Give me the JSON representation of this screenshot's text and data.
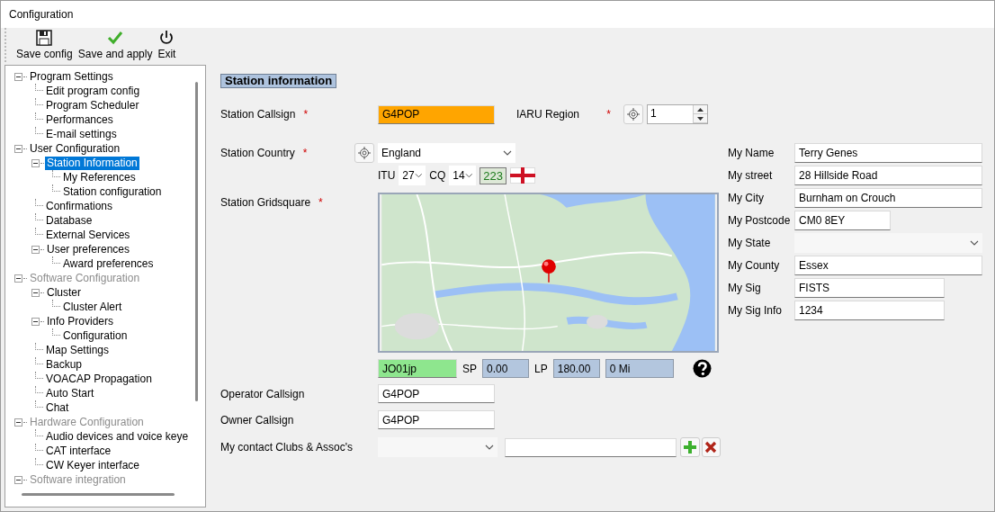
{
  "window": {
    "title": "Configuration"
  },
  "toolbar": [
    {
      "label": "Save config",
      "kind": "save"
    },
    {
      "label": "Save and apply",
      "kind": "apply"
    },
    {
      "label": "Exit",
      "kind": "exit"
    }
  ],
  "tree": [
    {
      "label": "Program Settings",
      "expanded": true,
      "disabled": false,
      "selected": false,
      "children": [
        {
          "label": "Edit program config",
          "disabled": false,
          "selected": false
        },
        {
          "label": "Program Scheduler",
          "disabled": false,
          "selected": false
        },
        {
          "label": "Performances",
          "disabled": false,
          "selected": false
        },
        {
          "label": "E-mail settings",
          "disabled": false,
          "selected": false
        }
      ]
    },
    {
      "label": "User Configuration",
      "expanded": true,
      "disabled": false,
      "selected": false,
      "children": [
        {
          "label": "Station Information",
          "expanded": true,
          "disabled": false,
          "selected": true,
          "children": [
            {
              "label": "My References",
              "disabled": false,
              "selected": false
            },
            {
              "label": "Station configuration",
              "disabled": false,
              "selected": false
            }
          ]
        },
        {
          "label": "Confirmations",
          "disabled": false,
          "selected": false
        },
        {
          "label": "Database",
          "disabled": false,
          "selected": false
        },
        {
          "label": "External Services",
          "disabled": false,
          "selected": false
        },
        {
          "label": "User preferences",
          "expanded": true,
          "disabled": false,
          "selected": false,
          "children": [
            {
              "label": "Award preferences",
              "disabled": false,
              "selected": false
            }
          ]
        }
      ]
    },
    {
      "label": "Software Configuration",
      "expanded": true,
      "disabled": true,
      "selected": false,
      "children": [
        {
          "label": "Cluster",
          "expanded": true,
          "disabled": false,
          "selected": false,
          "children": [
            {
              "label": "Cluster Alert",
              "disabled": false,
              "selected": false
            }
          ]
        },
        {
          "label": "Info Providers",
          "expanded": true,
          "disabled": false,
          "selected": false,
          "children": [
            {
              "label": "Configuration",
              "disabled": false,
              "selected": false
            }
          ]
        },
        {
          "label": "Map Settings",
          "disabled": false,
          "selected": false
        },
        {
          "label": "Backup",
          "disabled": false,
          "selected": false
        },
        {
          "label": "VOACAP Propagation",
          "disabled": false,
          "selected": false
        },
        {
          "label": "Auto Start",
          "disabled": false,
          "selected": false
        },
        {
          "label": "Chat",
          "disabled": false,
          "selected": false
        }
      ]
    },
    {
      "label": "Hardware Configuration",
      "expanded": true,
      "disabled": true,
      "selected": false,
      "children": [
        {
          "label": "Audio devices and voice keye",
          "disabled": false,
          "selected": false
        },
        {
          "label": "CAT interface",
          "disabled": false,
          "selected": false
        },
        {
          "label": "CW Keyer interface",
          "disabled": false,
          "selected": false
        }
      ]
    },
    {
      "label": "Software integration",
      "expanded": true,
      "disabled": true,
      "selected": false
    }
  ],
  "section_title": "Station information",
  "station": {
    "callsign": {
      "label": "Station Callsign",
      "required_mark": "*",
      "value": "G4POP"
    },
    "iaru_region": {
      "label": "IARU Region",
      "required_mark": "*",
      "value": "1"
    },
    "country": {
      "label": "Station Country",
      "required_mark": "*",
      "value": "England"
    },
    "itu": {
      "label": "ITU",
      "value": "27"
    },
    "cq": {
      "label": "CQ",
      "value": "14"
    },
    "dxcc": "223",
    "gridsquare": {
      "label": "Station Gridsquare",
      "required_mark": "*"
    },
    "locator": "JO01jp",
    "sp": {
      "label": "SP",
      "value": "0.00"
    },
    "lp": {
      "label": "LP",
      "value": "180.00"
    },
    "distance": "0 Mi",
    "operator_callsign": {
      "label": "Operator Callsign",
      "value": "G4POP"
    },
    "owner_callsign": {
      "label": "Owner Callsign",
      "value": "G4POP"
    },
    "clubs": {
      "label": "My contact Clubs & Assoc's"
    }
  },
  "address": [
    {
      "label": "My Name",
      "kind": "text",
      "value": "Terry Genes"
    },
    {
      "label": "My street",
      "kind": "text",
      "value": "28 Hillside Road"
    },
    {
      "label": "My City",
      "kind": "text",
      "value": "Burnham on Crouch"
    },
    {
      "label": "My Postcode",
      "kind": "text",
      "value": "CM0 8EY"
    },
    {
      "label": "My State",
      "kind": "combo"
    },
    {
      "label": "My County",
      "kind": "text",
      "value": "Essex"
    },
    {
      "label": "My Sig",
      "kind": "text",
      "value": "FISTS"
    },
    {
      "label": "My Sig Info",
      "kind": "text",
      "value": "1234"
    }
  ]
}
